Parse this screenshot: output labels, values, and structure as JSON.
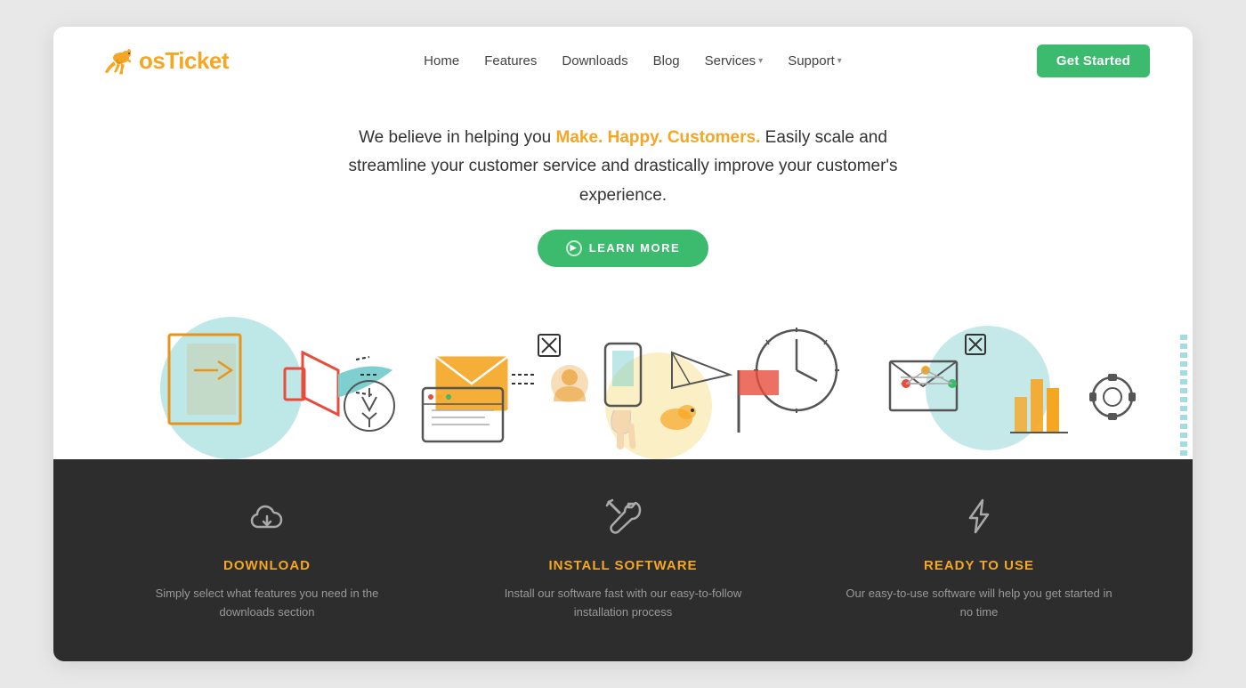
{
  "nav": {
    "logo_os": "os",
    "logo_ticket": "Ticket",
    "links": [
      {
        "label": "Home",
        "name": "home"
      },
      {
        "label": "Features",
        "name": "features"
      },
      {
        "label": "Downloads",
        "name": "downloads"
      },
      {
        "label": "Blog",
        "name": "blog"
      },
      {
        "label": "Services",
        "name": "services",
        "dropdown": true
      },
      {
        "label": "Support",
        "name": "support",
        "dropdown": true
      }
    ],
    "cta_label": "Get Started"
  },
  "hero": {
    "text_before": "We believe in helping you",
    "highlight": "Make. Happy. Customers.",
    "text_after": "Easily scale and streamline your customer service and drastically improve your customer's experience.",
    "learn_more": "LEARN MORE"
  },
  "features": [
    {
      "id": "download",
      "icon": "cloud-download",
      "title": "DOWNLOAD",
      "description": "Simply select what features you need in the downloads section"
    },
    {
      "id": "install",
      "icon": "wrench",
      "title": "INSTALL SOFTWARE",
      "description": "Install our software fast with our easy-to-follow installation process"
    },
    {
      "id": "ready",
      "icon": "lightning",
      "title": "READY TO USE",
      "description": "Our easy-to-use software will help you get started in no time"
    }
  ]
}
